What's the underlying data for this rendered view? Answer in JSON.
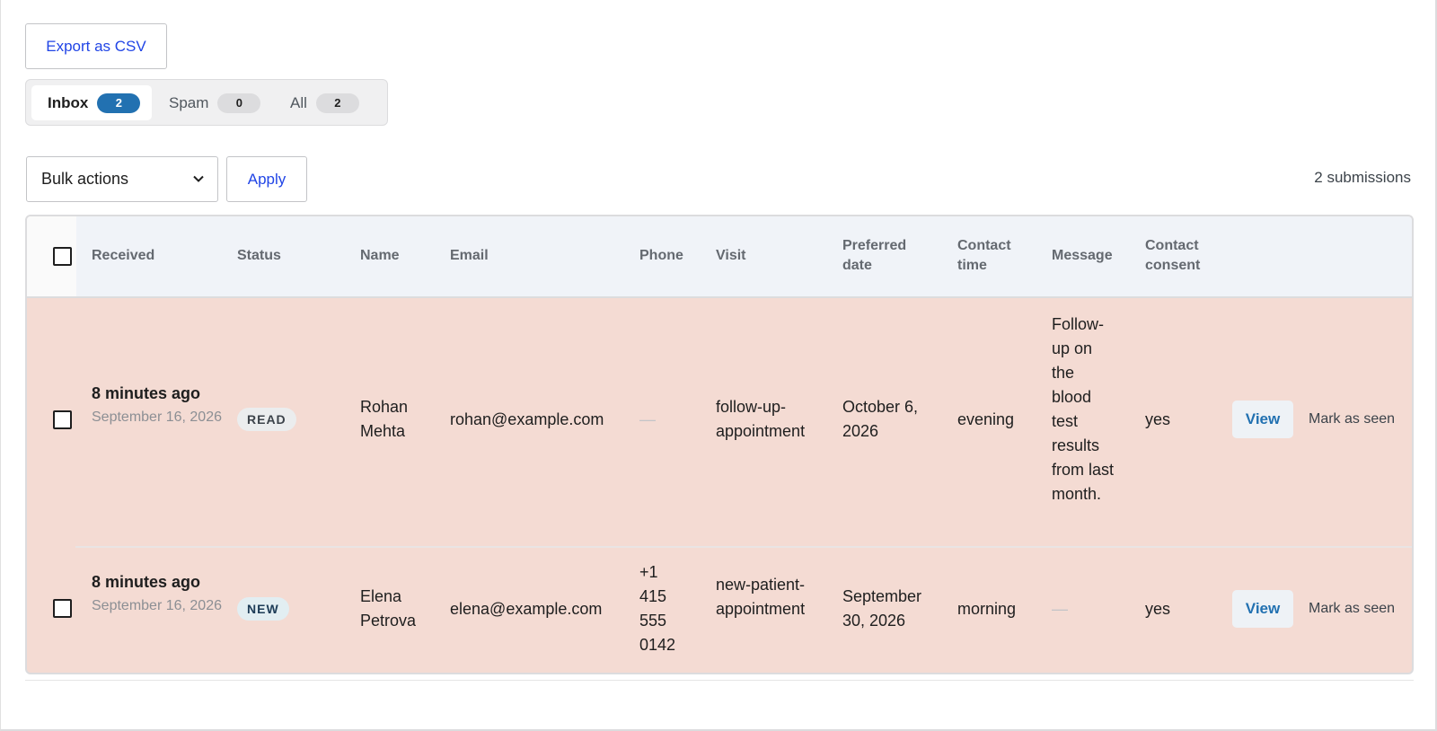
{
  "toolbar": {
    "export_label": "Export as CSV",
    "bulk_select_value": "Bulk actions",
    "apply_label": "Apply",
    "submission_count": "2 submissions"
  },
  "tabs": [
    {
      "label": "Inbox",
      "count": "2",
      "active": true
    },
    {
      "label": "Spam",
      "count": "0",
      "active": false
    },
    {
      "label": "All",
      "count": "2",
      "active": false
    }
  ],
  "table": {
    "headers": {
      "received": "Received",
      "status": "Status",
      "name": "Name",
      "email": "Email",
      "phone": "Phone",
      "visit": "Visit",
      "preferred_date": "Preferred date",
      "contact_time": "Contact time",
      "message": "Message",
      "contact_consent": "Contact consent"
    },
    "rows": [
      {
        "received_rel": "8 minutes ago",
        "received_date": "September 16, 2026",
        "status": "READ",
        "name": "Rohan Mehta",
        "email": "rohan@example.com",
        "phone": "—",
        "visit": "follow-up-appointment",
        "preferred_date": "October 6, 2026",
        "contact_time": "evening",
        "message": "Follow-up on the blood test results from last month.",
        "contact_consent": "yes",
        "view_label": "View",
        "mark_label": "Mark as seen"
      },
      {
        "received_rel": "8 minutes ago",
        "received_date": "September 16, 2026",
        "status": "NEW",
        "name": "Elena Petrova",
        "email": "elena@example.com",
        "phone": "+1 415 555 0142",
        "visit": "new-patient-appointment",
        "preferred_date": "September 30, 2026",
        "contact_time": "morning",
        "message": "—",
        "contact_consent": "yes",
        "view_label": "View",
        "mark_label": "Mark as seen"
      }
    ]
  },
  "colors": {
    "accent": "#2271b1",
    "link": "#2145e6",
    "row_highlight": "#f4dbd3",
    "header_bg": "#f0f3f8"
  }
}
